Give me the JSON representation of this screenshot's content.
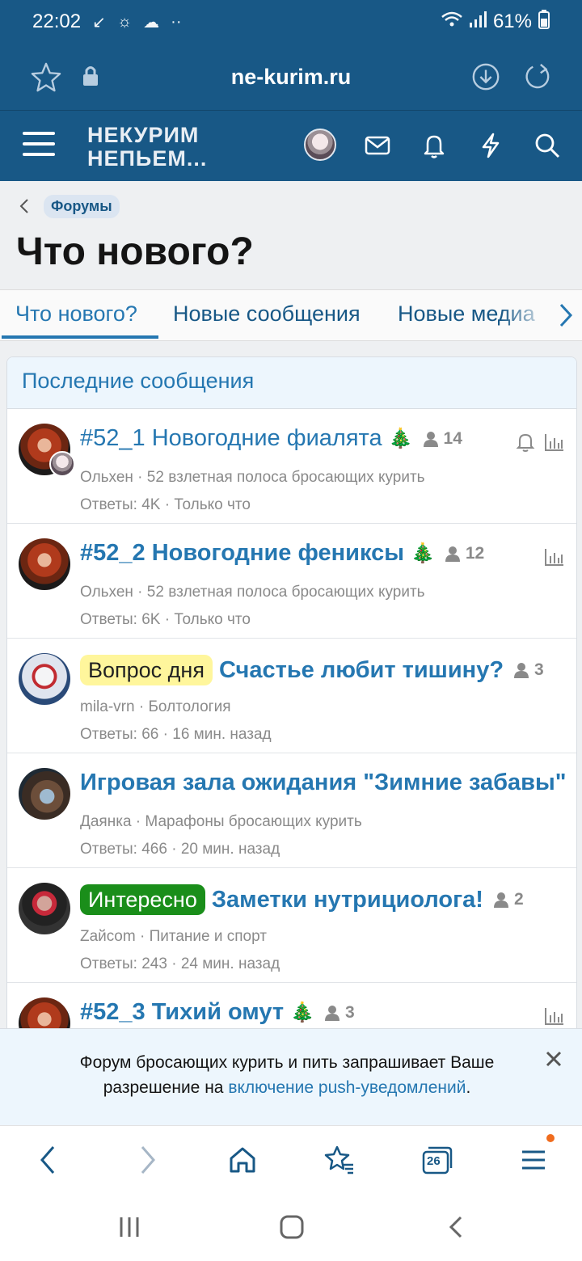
{
  "status_bar": {
    "time": "22:02",
    "battery": "61%"
  },
  "browser": {
    "url": "ne-kurim.ru",
    "tab_count": "26"
  },
  "site": {
    "logo_line1": "НЕКУРИМ",
    "logo_line2": "НЕПЬЕМ..."
  },
  "breadcrumb": {
    "label": "Форумы"
  },
  "page": {
    "title": "Что нового?"
  },
  "tabs": [
    {
      "label": "Что нового?"
    },
    {
      "label": "Новые сообщения"
    },
    {
      "label": "Новые медиа"
    }
  ],
  "block": {
    "title": "Последние сообщения",
    "threads": [
      {
        "prefix": "",
        "title": "#52_1 Новогодние фиалята",
        "emoji": "🎄",
        "users": "14",
        "author": "Ольхен",
        "forum": "52 взлетная полоса бросающих курить",
        "replies": "Ответы: 4K",
        "time": "Только что"
      },
      {
        "prefix": "",
        "title": "#52_2 Новогодние фениксы",
        "emoji": "🎄",
        "users": "12",
        "author": "Ольхен",
        "forum": "52 взлетная полоса бросающих курить",
        "replies": "Ответы: 6K",
        "time": "Только что"
      },
      {
        "prefix": "Вопрос дня",
        "title": "Счастье любит тишину?",
        "emoji": "",
        "users": "3",
        "author": "mila-vrn",
        "forum": "Болтология",
        "replies": "Ответы: 66",
        "time": "16 мин. назад"
      },
      {
        "prefix": "",
        "title": "Игровая зала ожидания \"Зимние забавы\"",
        "emoji": "",
        "users": "",
        "author": "Даянка",
        "forum": "Марафоны бросающих курить",
        "replies": "Ответы: 466",
        "time": "20 мин. назад"
      },
      {
        "prefix": "Интересно",
        "title": "Заметки нутрициолога!",
        "emoji": "",
        "users": "2",
        "author": "Zайcom",
        "forum": "Питание и спорт",
        "replies": "Ответы: 243",
        "time": "24 мин. назад"
      },
      {
        "prefix": "",
        "title": "#52_3 Тихий омут",
        "emoji": "🎄",
        "users": "3",
        "author": "",
        "forum": "",
        "replies": "",
        "time": ""
      }
    ]
  },
  "push_notice": {
    "text_before": "Форум бросающих курить и пить запрашивает Ваше разрешение на ",
    "link": "включение push-уведомлений",
    "text_after": "."
  },
  "colors": {
    "header": "#185886",
    "link": "#2577b1",
    "prefix_yellow": "#fff69c",
    "prefix_green": "#1a8e1a",
    "dot": "#f06c1e"
  }
}
